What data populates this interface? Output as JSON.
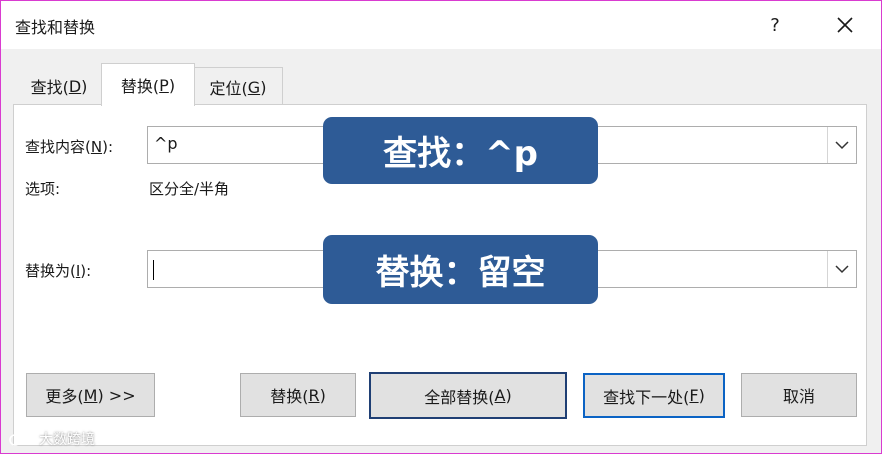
{
  "window": {
    "title": "查找和替换",
    "help_label": "?"
  },
  "tabs": [
    {
      "pre": "查找(",
      "key": "D",
      "post": ")"
    },
    {
      "pre": "替换(",
      "key": "P",
      "post": ")"
    },
    {
      "pre": "定位(",
      "key": "G",
      "post": ")"
    }
  ],
  "find": {
    "label_pre": "查找内容(",
    "label_key": "N",
    "label_post": "):",
    "value": "^p"
  },
  "options": {
    "label": "选项:",
    "value": "区分全/半角"
  },
  "replace": {
    "label_pre": "替换为(",
    "label_key": "I",
    "label_post": "):",
    "value": ""
  },
  "callouts": {
    "find": "查找：^p",
    "replace": "替换：留空"
  },
  "buttons": {
    "more": {
      "pre": "更多(",
      "key": "M",
      "post": ") >>"
    },
    "replace": {
      "pre": "替换(",
      "key": "R",
      "post": ")"
    },
    "replace_all": {
      "pre": "全部替换(",
      "key": "A",
      "post": ")"
    },
    "find_next": {
      "pre": "查找下一处(",
      "key": "F",
      "post": ")"
    },
    "cancel": {
      "label": "取消"
    }
  },
  "watermark": "大数跨境"
}
